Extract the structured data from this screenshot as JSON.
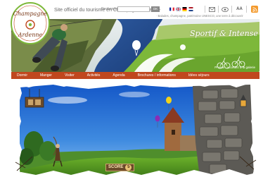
{
  "header": {
    "logo_line1": "Champagne",
    "logo_line2": "Ardenne",
    "tagline": "Site officiel du tourisme en Champagne-Ardenne",
    "subtagline": "· Balades, champagne, patrimoine UNESCO, une terre à découvrir"
  },
  "toolbar": {
    "search_label": "Recherche",
    "search_value": "",
    "search_button": "OK",
    "font_size_label": "AA",
    "mail_icon": "envelope-icon",
    "share_icon": "share-icon",
    "rss_icon": "rss-icon",
    "languages": [
      {
        "name": "fr",
        "colors": [
          "#002395",
          "#ffffff",
          "#ed2939"
        ]
      },
      {
        "name": "en",
        "colors": [
          "#012169",
          "#ffffff",
          "#c8102e"
        ]
      },
      {
        "name": "de",
        "colors": [
          "#000000",
          "#dd0000",
          "#ffce00"
        ]
      },
      {
        "name": "nl",
        "colors": [
          "#ae1c28",
          "#ffffff",
          "#21468b"
        ]
      }
    ]
  },
  "banner": {
    "title": "Sportif & Intense",
    "link_text": "Photos : accédez à la galerie"
  },
  "nav": {
    "items": [
      "Dormir",
      "Manger",
      "Visiter",
      "Activités",
      "Agenda",
      "Brochures / informations",
      "Idées séjours"
    ]
  },
  "game": {
    "score_label": "SCORE",
    "score_value": "5"
  },
  "colors": {
    "nav_bg": "#c0471e",
    "accent_green": "#7db83a",
    "sky": "#1a6fd0"
  }
}
